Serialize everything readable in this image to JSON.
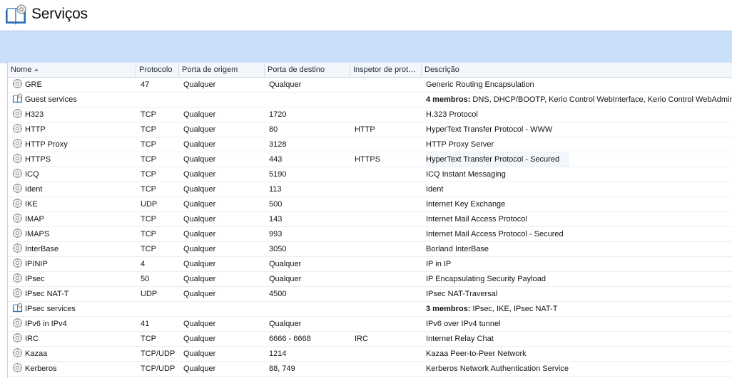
{
  "page": {
    "title": "Serviços"
  },
  "columns": {
    "name": "Nome",
    "protocol": "Protocolo",
    "source_port": "Porta de origem",
    "dest_port": "Porta de destino",
    "inspector": "Inspetor de prot…",
    "description": "Descrição"
  },
  "rows": [
    {
      "name": "GRE",
      "type": "service",
      "protocol": "47",
      "source_port": "Qualquer",
      "dest_port": "Qualquer",
      "inspector": "",
      "description": "Generic Routing Encapsulation"
    },
    {
      "name": "Guest services",
      "type": "group",
      "protocol": "",
      "source_port": "",
      "dest_port": "",
      "inspector": "",
      "members_label": "4 membros:",
      "description": "DNS, DHCP/BOOTP, Kerio Control WebInterface, Kerio Control WebAdmin"
    },
    {
      "name": "H323",
      "type": "service",
      "protocol": "TCP",
      "source_port": "Qualquer",
      "dest_port": "1720",
      "inspector": "",
      "description": "H.323 Protocol"
    },
    {
      "name": "HTTP",
      "type": "service",
      "protocol": "TCP",
      "source_port": "Qualquer",
      "dest_port": "80",
      "inspector": "HTTP",
      "description": "HyperText Transfer Protocol - WWW"
    },
    {
      "name": "HTTP Proxy",
      "type": "service",
      "protocol": "TCP",
      "source_port": "Qualquer",
      "dest_port": "3128",
      "inspector": "",
      "description": "HTTP Proxy Server"
    },
    {
      "name": "HTTPS",
      "type": "service",
      "protocol": "TCP",
      "source_port": "Qualquer",
      "dest_port": "443",
      "inspector": "HTTPS",
      "description": "HyperText Transfer Protocol - Secured",
      "highlight": true
    },
    {
      "name": "ICQ",
      "type": "service",
      "protocol": "TCP",
      "source_port": "Qualquer",
      "dest_port": "5190",
      "inspector": "",
      "description": "ICQ Instant Messaging"
    },
    {
      "name": "Ident",
      "type": "service",
      "protocol": "TCP",
      "source_port": "Qualquer",
      "dest_port": "113",
      "inspector": "",
      "description": "Ident"
    },
    {
      "name": "IKE",
      "type": "service",
      "protocol": "UDP",
      "source_port": "Qualquer",
      "dest_port": "500",
      "inspector": "",
      "description": "Internet Key Exchange"
    },
    {
      "name": "IMAP",
      "type": "service",
      "protocol": "TCP",
      "source_port": "Qualquer",
      "dest_port": "143",
      "inspector": "",
      "description": "Internet Mail Access Protocol"
    },
    {
      "name": "IMAPS",
      "type": "service",
      "protocol": "TCP",
      "source_port": "Qualquer",
      "dest_port": "993",
      "inspector": "",
      "description": "Internet Mail Access Protocol - Secured"
    },
    {
      "name": "InterBase",
      "type": "service",
      "protocol": "TCP",
      "source_port": "Qualquer",
      "dest_port": "3050",
      "inspector": "",
      "description": "Borland InterBase"
    },
    {
      "name": "IPINIP",
      "type": "service",
      "protocol": "4",
      "source_port": "Qualquer",
      "dest_port": "Qualquer",
      "inspector": "",
      "description": "IP in IP"
    },
    {
      "name": "IPsec",
      "type": "service",
      "protocol": "50",
      "source_port": "Qualquer",
      "dest_port": "Qualquer",
      "inspector": "",
      "description": "IP Encapsulating Security Payload"
    },
    {
      "name": "IPsec NAT-T",
      "type": "service",
      "protocol": "UDP",
      "source_port": "Qualquer",
      "dest_port": "4500",
      "inspector": "",
      "description": "IPsec NAT-Traversal"
    },
    {
      "name": "IPsec services",
      "type": "group",
      "protocol": "",
      "source_port": "",
      "dest_port": "",
      "inspector": "",
      "members_label": "3 membros:",
      "description": "IPsec, IKE, IPsec NAT-T"
    },
    {
      "name": "IPv6 in IPv4",
      "type": "service",
      "protocol": "41",
      "source_port": "Qualquer",
      "dest_port": "Qualquer",
      "inspector": "",
      "description": "IPv6 over IPv4 tunnel"
    },
    {
      "name": "IRC",
      "type": "service",
      "protocol": "TCP",
      "source_port": "Qualquer",
      "dest_port": "6666 - 6668",
      "inspector": "IRC",
      "description": "Internet Relay Chat"
    },
    {
      "name": "Kazaa",
      "type": "service",
      "protocol": "TCP/UDP",
      "source_port": "Qualquer",
      "dest_port": "1214",
      "inspector": "",
      "description": "Kazaa Peer-to-Peer Network"
    },
    {
      "name": "Kerberos",
      "type": "service",
      "protocol": "TCP/UDP",
      "source_port": "Qualquer",
      "dest_port": "88, 749",
      "inspector": "",
      "description": "Kerberos Network Authentication Service"
    }
  ]
}
